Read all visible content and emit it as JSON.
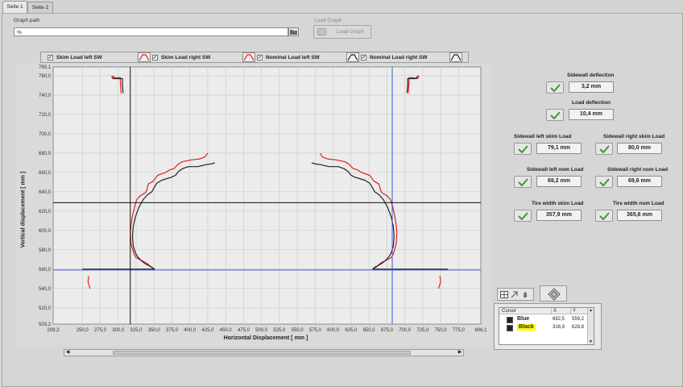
{
  "tabs": [
    {
      "label": "Seite 1"
    },
    {
      "label": "Seite 2"
    }
  ],
  "graph_path": {
    "label": "Graph path",
    "value": "%"
  },
  "load_graph": {
    "group_label": "Load Graph",
    "button_label": "Load Graph"
  },
  "legend": [
    {
      "label": "Skim Load left SW",
      "color": "#e02020",
      "checked": "✓"
    },
    {
      "label": "Skim Load right SW",
      "color": "#e02020",
      "checked": "✓"
    },
    {
      "label": "Nominal Load left SW",
      "color": "#222222",
      "checked": "✓"
    },
    {
      "label": "Nominal Load right SW",
      "color": "#222222",
      "checked": "✓"
    }
  ],
  "chart_data": {
    "type": "scatter",
    "xlabel": "Horizontal Displacement [ mm ]",
    "ylabel": "Vertical displacement [ mm ]",
    "xlim": [
      209.3,
      806.1
    ],
    "ylim": [
      503.2,
      769.1
    ],
    "xticks": [
      "209,3",
      "250,0",
      "275,0",
      "300,0",
      "325,0",
      "350,0",
      "375,0",
      "400,0",
      "425,0",
      "450,0",
      "475,0",
      "500,0",
      "525,0",
      "550,0",
      "575,0",
      "600,0",
      "625,0",
      "650,0",
      "675,0",
      "700,0",
      "725,0",
      "750,0",
      "775,0",
      "806,1"
    ],
    "yticks": [
      "503,2",
      "520,0",
      "540,0",
      "560,0",
      "580,0",
      "600,0",
      "620,0",
      "640,0",
      "660,0",
      "680,0",
      "700,0",
      "720,0",
      "740,0",
      "760,0",
      "769,1"
    ],
    "grid": true,
    "series": [
      {
        "name": "Skim Load left SW",
        "color": "#e02020",
        "segments": [
          [
            [
              291,
              760
            ],
            [
              292,
              757
            ],
            [
              296,
              758
            ],
            [
              303,
              758
            ],
            [
              303,
              755
            ],
            [
              304,
              742
            ]
          ],
          [
            [
              425,
              680
            ],
            [
              421,
              676
            ],
            [
              414,
              674
            ],
            [
              402,
              673
            ],
            [
              389,
              671
            ],
            [
              383,
              668
            ],
            [
              378,
              664
            ],
            [
              373,
              663
            ],
            [
              366,
              660
            ],
            [
              355,
              657
            ],
            [
              349,
              651
            ],
            [
              342,
              648
            ],
            [
              340,
              642
            ],
            [
              338,
              639
            ],
            [
              331,
              636
            ],
            [
              326,
              632
            ],
            [
              323,
              625
            ],
            [
              320,
              615
            ],
            [
              318,
              606
            ],
            [
              317,
              598
            ],
            [
              318,
              586
            ],
            [
              322,
              576
            ],
            [
              325,
              572
            ],
            [
              330,
              570
            ],
            [
              338,
              567
            ],
            [
              342,
              565
            ],
            [
              346,
              562
            ],
            [
              349,
              561
            ]
          ],
          [
            [
              259,
              553
            ],
            [
              258,
              547
            ],
            [
              260,
              542
            ],
            [
              261,
              540
            ]
          ]
        ]
      },
      {
        "name": "Skim Load right SW",
        "color": "#e02020",
        "segments": [
          [
            [
              720,
              760
            ],
            [
              718,
              757
            ],
            [
              712,
              758
            ],
            [
              706,
              758
            ],
            [
              706,
              755
            ],
            [
              705,
              742
            ]
          ],
          [
            [
              582,
              680
            ],
            [
              585,
              676
            ],
            [
              592,
              674
            ],
            [
              604,
              673
            ],
            [
              617,
              671
            ],
            [
              623,
              668
            ],
            [
              628,
              664
            ],
            [
              633,
              663
            ],
            [
              640,
              660
            ],
            [
              651,
              657
            ],
            [
              657,
              651
            ],
            [
              664,
              648
            ],
            [
              666,
              642
            ],
            [
              668,
              639
            ],
            [
              675,
              636
            ],
            [
              680,
              632
            ],
            [
              683,
              625
            ],
            [
              686,
              615
            ],
            [
              688,
              606
            ],
            [
              689,
              598
            ],
            [
              688,
              586
            ],
            [
              684,
              576
            ],
            [
              681,
              572
            ],
            [
              676,
              570
            ],
            [
              668,
              567
            ],
            [
              664,
              565
            ],
            [
              660,
              562
            ],
            [
              657,
              561
            ]
          ],
          [
            [
              749,
              553
            ],
            [
              750,
              547
            ],
            [
              748,
              542
            ],
            [
              747,
              540
            ]
          ]
        ]
      },
      {
        "name": "Nominal Load left SW",
        "color": "#222222",
        "segments": [
          [
            [
              293,
              760
            ],
            [
              294,
              757
            ],
            [
              299,
              757
            ],
            [
              306,
              757
            ],
            [
              306,
              750
            ],
            [
              307,
              742
            ]
          ],
          [
            [
              435,
              670
            ],
            [
              431,
              669
            ],
            [
              422,
              668
            ],
            [
              411,
              666
            ],
            [
              398,
              666
            ],
            [
              390,
              664
            ],
            [
              384,
              661
            ],
            [
              380,
              657
            ],
            [
              374,
              655
            ],
            [
              361,
              652
            ],
            [
              354,
              649
            ],
            [
              350,
              644
            ],
            [
              347,
              640
            ],
            [
              341,
              637
            ],
            [
              335,
              632
            ],
            [
              329,
              624
            ],
            [
              324,
              614
            ],
            [
              321,
              604
            ],
            [
              320,
              594
            ],
            [
              321,
              584
            ],
            [
              324,
              577
            ],
            [
              327,
              573
            ],
            [
              332,
              569
            ],
            [
              337,
              566
            ],
            [
              342,
              564
            ],
            [
              347,
              562
            ],
            [
              351,
              560
            ]
          ],
          [
            [
              250,
              560
            ],
            [
              280,
              560
            ],
            [
              311,
              560
            ],
            [
              333,
              560
            ],
            [
              351,
              560
            ]
          ]
        ]
      },
      {
        "name": "Nominal Load right SW",
        "color": "#222222",
        "segments": [
          [
            [
              718,
              760
            ],
            [
              716,
              757
            ],
            [
              710,
              757
            ],
            [
              704,
              757
            ],
            [
              704,
              750
            ],
            [
              703,
              742
            ]
          ],
          [
            [
              570,
              670
            ],
            [
              574,
              669
            ],
            [
              583,
              668
            ],
            [
              594,
              666
            ],
            [
              607,
              666
            ],
            [
              615,
              664
            ],
            [
              621,
              661
            ],
            [
              625,
              657
            ],
            [
              631,
              655
            ],
            [
              644,
              652
            ],
            [
              651,
              649
            ],
            [
              655,
              644
            ],
            [
              658,
              640
            ],
            [
              664,
              637
            ],
            [
              670,
              632
            ],
            [
              676,
              624
            ],
            [
              681,
              614
            ],
            [
              684,
              604
            ],
            [
              685,
              594
            ],
            [
              684,
              584
            ],
            [
              681,
              577
            ],
            [
              678,
              573
            ],
            [
              673,
              569
            ],
            [
              668,
              566
            ],
            [
              663,
              564
            ],
            [
              658,
              562
            ],
            [
              655,
              560
            ]
          ],
          [
            [
              655,
              560
            ],
            [
              677,
              560
            ],
            [
              700,
              560
            ],
            [
              730,
              560
            ],
            [
              760,
              560
            ]
          ]
        ]
      }
    ],
    "cursors": [
      {
        "name": "Blue",
        "x": 682.5,
        "y": 559.2,
        "color": "#3b5bdb",
        "x_text": "682,5",
        "y_text": "559,2"
      },
      {
        "name": "Black",
        "x": 316.9,
        "y": 628.8,
        "color": "#111111",
        "x_text": "316,9",
        "y_text": "628,8"
      }
    ]
  },
  "indicators": {
    "sidewall_deflection": {
      "label": "Sidewall deflection",
      "value": "3,2 mm"
    },
    "load_deflection": {
      "label": "Load deflection",
      "value": "10,4 mm"
    },
    "sw_left_skim": {
      "label": "Sidewall left skim Load",
      "value": "79,1 mm"
    },
    "sw_right_skim": {
      "label": "Sidewall right skim Load",
      "value": "80,0 mm"
    },
    "sw_left_nom": {
      "label": "Sidewall left nom Load",
      "value": "69,2 mm"
    },
    "sw_right_nom": {
      "label": "Sidewall right nom Load",
      "value": "69,6 mm"
    },
    "tire_width_skim": {
      "label": "Tire width skim Load",
      "value": "357,9 mm"
    },
    "tire_width_nom": {
      "label": "Tire width nom Load",
      "value": "365,6 mm"
    }
  },
  "cursor_table": {
    "headers": {
      "cursor": "Cursor",
      "x": "X",
      "y": "Y"
    },
    "rows": [
      {
        "name": "Blue",
        "x": "682,5",
        "y": "559,2"
      },
      {
        "name": "Black",
        "x": "316,9",
        "y": "628,8"
      }
    ]
  }
}
